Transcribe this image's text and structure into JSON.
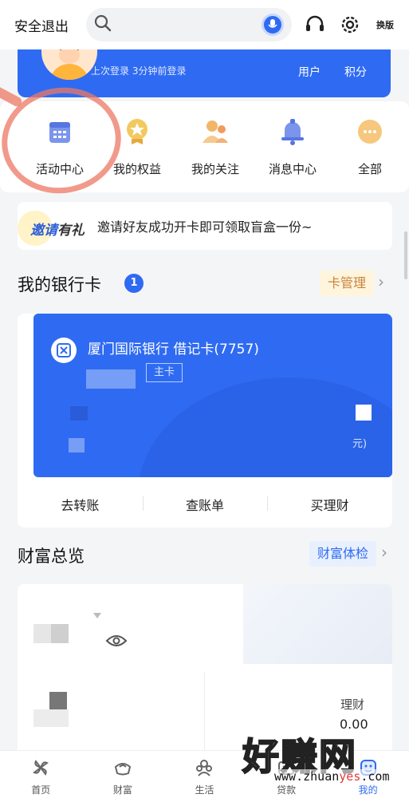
{
  "topbar": {
    "logout_label": "安全退出",
    "version_switch_line1": "换",
    "version_switch_line2": "版"
  },
  "profile": {
    "last_login": "上次登录 3分钟前登录",
    "stat_users": "用户",
    "stat_points": "积分"
  },
  "quick_menu": {
    "items": [
      {
        "label": "活动中心",
        "icon": "activity-center-icon"
      },
      {
        "label": "我的权益",
        "icon": "benefits-icon"
      },
      {
        "label": "我的关注",
        "icon": "following-icon"
      },
      {
        "label": "消息中心",
        "icon": "bell-icon"
      },
      {
        "label": "全部",
        "icon": "more-icon"
      }
    ]
  },
  "invite": {
    "badge_a": "邀请",
    "badge_b": "有礼",
    "message": "邀请好友成功开卡即可领取盲盒一份~"
  },
  "bank_cards": {
    "title": "我的银行卡",
    "count": "1",
    "manage_label": "卡管理",
    "card": {
      "name": "厦门国际银行 借记卡(7757)",
      "tag": "主卡",
      "tail_text": "元)"
    },
    "actions": [
      "去转账",
      "查账单",
      "买理财"
    ]
  },
  "wealth": {
    "title": "财富总览",
    "checkup_label": "财富体检",
    "finance_label": "理财",
    "finance_value": "0.00"
  },
  "tabbar": {
    "tabs": [
      {
        "label": "首页",
        "icon": "home-icon",
        "active": false
      },
      {
        "label": "财富",
        "icon": "wealth-icon",
        "active": false
      },
      {
        "label": "生活",
        "icon": "life-icon",
        "active": false
      },
      {
        "label": "贷款",
        "icon": "loan-icon",
        "active": false
      },
      {
        "label": "我的",
        "icon": "mine-icon",
        "active": true
      }
    ]
  },
  "watermark": {
    "text_cn": "好赚网",
    "url_a": "www.zhuan",
    "url_b": "yes",
    "url_c": ".com"
  },
  "colors": {
    "accent": "#2f6bf2",
    "manage_bg": "#fff4dc",
    "manage_fg": "#c7853b",
    "checkup_bg": "#e8f0fe",
    "checkup_fg": "#2f6bf2"
  }
}
